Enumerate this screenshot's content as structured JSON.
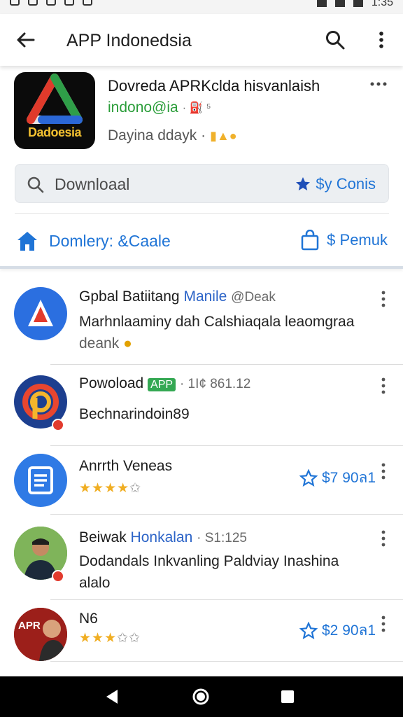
{
  "status_bar": {
    "time": "1:35"
  },
  "app_bar": {
    "title": "APP Indonedsia"
  },
  "hero": {
    "title": "Dovreda APRKclda hisvanlaish",
    "subtitle": "indono@ia",
    "subtitle_extra": "· ⛽ ⁵",
    "meta": "Dayina ddayk ·",
    "icon_brand": "Dadoesia"
  },
  "search": {
    "placeholder": "Downloaal",
    "coins_label": "$y Conis"
  },
  "tabs": {
    "left_label": "Domlery: &Caale",
    "right_label": "$ Pemuk"
  },
  "items": [
    {
      "name": "Gpbal Batiitang",
      "name_hl": "Manile",
      "name_meta": "@Deak",
      "desc": "Marhnlaaminy dah Calshiaqala leaomgraa",
      "desc_tail": "deank"
    },
    {
      "name": "Powoload",
      "badge": "APP",
      "name_meta": "· 1I¢ 861.12",
      "desc": "Bechnarindoin89"
    },
    {
      "name": "Anrrth Veneas",
      "stars": "★★★★",
      "stars_grey": "✩",
      "rating": "$7 90ล1"
    },
    {
      "name": "Beiwak",
      "name_hl": "Honkalan",
      "name_meta": "· S1:125",
      "desc": "Dodandals Inkvanling Paldviay Inashina",
      "desc_tail": "alalo"
    },
    {
      "name": "N6",
      "stars": "★★★",
      "stars_grey": "✩✩",
      "rating": "$2 90ล1"
    }
  ],
  "colors": {
    "accent": "#1f74d6",
    "green": "#2a9d39",
    "star": "#f0ae23"
  },
  "icons": [
    "back-arrow-icon",
    "search-icon",
    "more-vert-icon",
    "home-icon",
    "bag-icon",
    "star-icon",
    "back-triangle-icon",
    "home-circle-icon",
    "recents-square-icon"
  ]
}
